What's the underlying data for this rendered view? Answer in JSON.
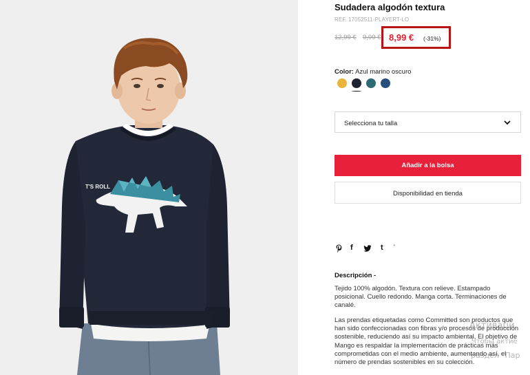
{
  "product": {
    "title": "Sudadera algodón textura",
    "reference": "REF. 17052511-PLAYERT-LO",
    "image_alt": "boy-wearing-navy-dinosaur-sweatshirt",
    "sweatshirt_print": "T'S ROLL"
  },
  "pricing": {
    "original_price": "12,99 €",
    "previous_price": "9,99 €",
    "current_price": "8,99 €",
    "discount": "(-31%)",
    "highlight_color": "#b81414",
    "price_color": "#e0202e"
  },
  "color": {
    "label": "Color:",
    "selected_name": "Azul marino oscuro",
    "swatches": [
      {
        "name": "mustard",
        "hex": "#e8b53a"
      },
      {
        "name": "navy-dark",
        "hex": "#1f2233",
        "selected": true
      },
      {
        "name": "teal",
        "hex": "#2c6a74"
      },
      {
        "name": "blue",
        "hex": "#244e7c"
      }
    ]
  },
  "size_select": {
    "label": "Selecciona tu talla"
  },
  "actions": {
    "add_to_bag": "Añadir a la bolsa",
    "store_availability": "Disponibilidad en tienda",
    "add_to_bag_color": "#e8203a"
  },
  "share": {
    "icons": [
      {
        "name": "pinterest-icon",
        "glyph": "P"
      },
      {
        "name": "facebook-icon",
        "glyph": "f"
      },
      {
        "name": "twitter-icon",
        "glyph": "🐦"
      },
      {
        "name": "tumblr-icon",
        "glyph": "t"
      },
      {
        "name": "more-icon",
        "glyph": "'"
      }
    ]
  },
  "description": {
    "title": "Descripción  -",
    "paragraph_1": "Tejido 100% algodón. Textura con relieve. Estampado posicional. Cuello redondo. Manga corta. Terminaciones de canalé.",
    "paragraph_2": "Las prendas etiquetadas como Committed son productos que han sido confeccionadas con fibras y/o procesos de producción sostenible, reduciendo así su impacto ambiental. El objetivo de Mango es respaldar la implementación de prácticas más comprometidas con el medio ambiente, aumentando así, el número de prendas sostenibles en su colección."
  },
  "os_watermark": {
    "line_1": "Активаци",
    "line_2": "Чтобы актие",
    "line_3": "раздел \"Пар"
  }
}
